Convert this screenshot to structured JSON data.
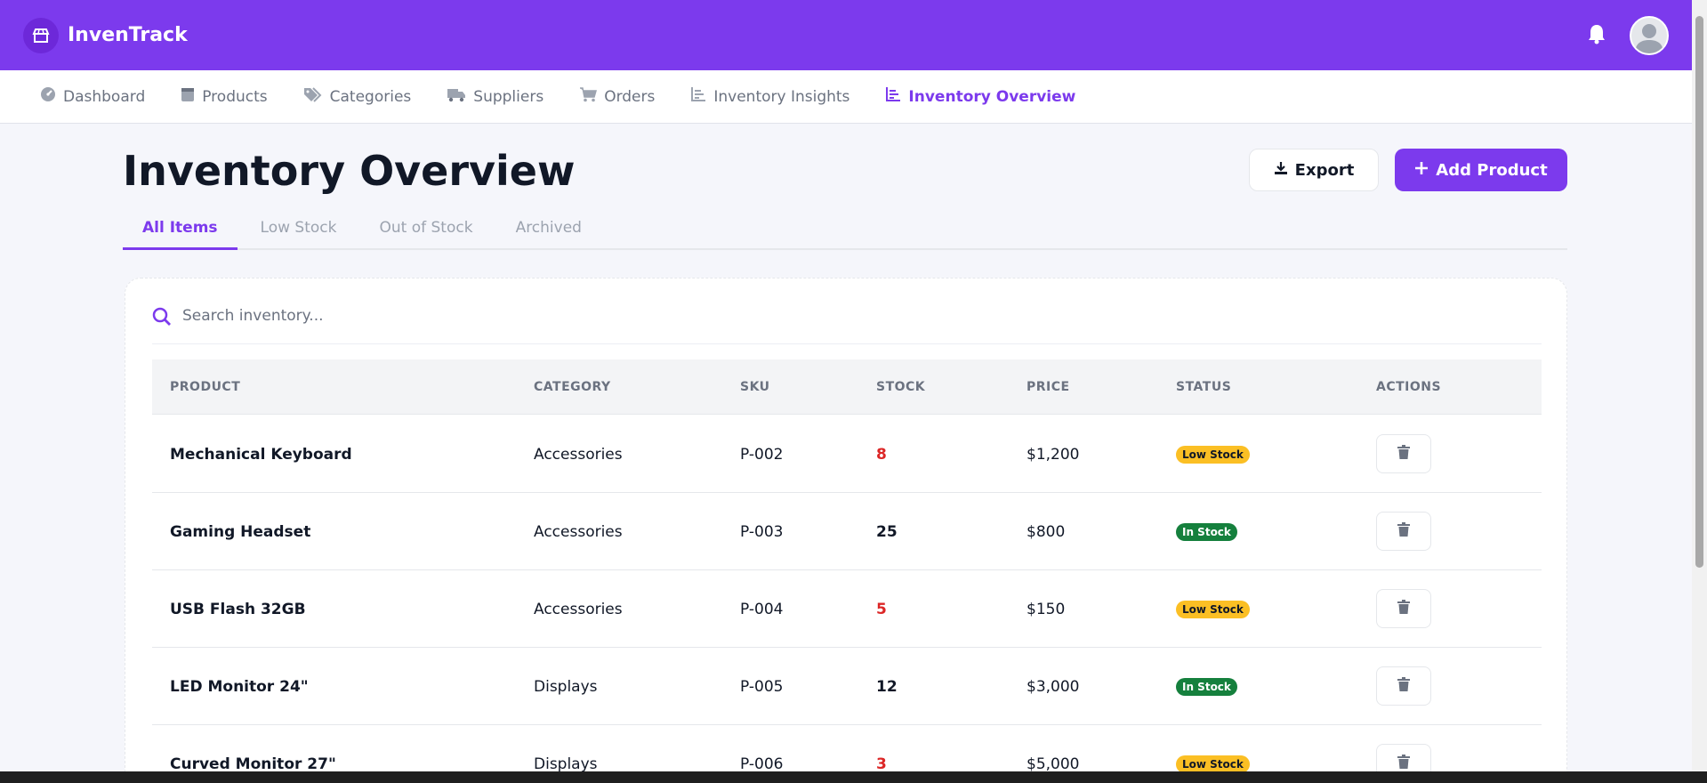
{
  "app": {
    "brand": "InvenTrack"
  },
  "header": {
    "icons": [
      "store-icon",
      "bell-icon",
      "user-avatar"
    ]
  },
  "nav": {
    "items": [
      {
        "label": "Dashboard",
        "icon": "dashboard-gauge-icon",
        "active": false
      },
      {
        "label": "Products",
        "icon": "box-icon",
        "active": false
      },
      {
        "label": "Categories",
        "icon": "tags-icon",
        "active": false
      },
      {
        "label": "Suppliers",
        "icon": "truck-icon",
        "active": false
      },
      {
        "label": "Orders",
        "icon": "cart-icon",
        "active": false
      },
      {
        "label": "Inventory Insights",
        "icon": "chart-icon",
        "active": false
      },
      {
        "label": "Inventory Overview",
        "icon": "chart-icon",
        "active": true
      }
    ]
  },
  "page": {
    "title": "Inventory Overview",
    "export_label": "Export",
    "add_label": "Add Product"
  },
  "tabs": [
    {
      "label": "All Items",
      "active": true
    },
    {
      "label": "Low Stock",
      "active": false
    },
    {
      "label": "Out of Stock",
      "active": false
    },
    {
      "label": "Archived",
      "active": false
    }
  ],
  "search": {
    "placeholder": "Search inventory..."
  },
  "table": {
    "headers": [
      "PRODUCT",
      "CATEGORY",
      "SKU",
      "STOCK",
      "PRICE",
      "STATUS",
      "ACTIONS"
    ],
    "rows": [
      {
        "product": "Mechanical Keyboard",
        "category": "Accessories",
        "sku": "P-002",
        "stock": "8",
        "price": "$1,200",
        "status": "Low Stock"
      },
      {
        "product": "Gaming Headset",
        "category": "Accessories",
        "sku": "P-003",
        "stock": "25",
        "price": "$800",
        "status": "In Stock"
      },
      {
        "product": "USB Flash 32GB",
        "category": "Accessories",
        "sku": "P-004",
        "stock": "5",
        "price": "$150",
        "status": "Low Stock"
      },
      {
        "product": "LED Monitor 24\"",
        "category": "Displays",
        "sku": "P-005",
        "stock": "12",
        "price": "$3,000",
        "status": "In Stock"
      },
      {
        "product": "Curved Monitor 27\"",
        "category": "Displays",
        "sku": "P-006",
        "stock": "3",
        "price": "$5,000",
        "status": "Low Stock"
      }
    ]
  },
  "colors": {
    "primary": "#7c3aed",
    "low_stock_badge": "#fbbf24",
    "in_stock_badge": "#15803d",
    "low_stock_text": "#dc2626"
  }
}
